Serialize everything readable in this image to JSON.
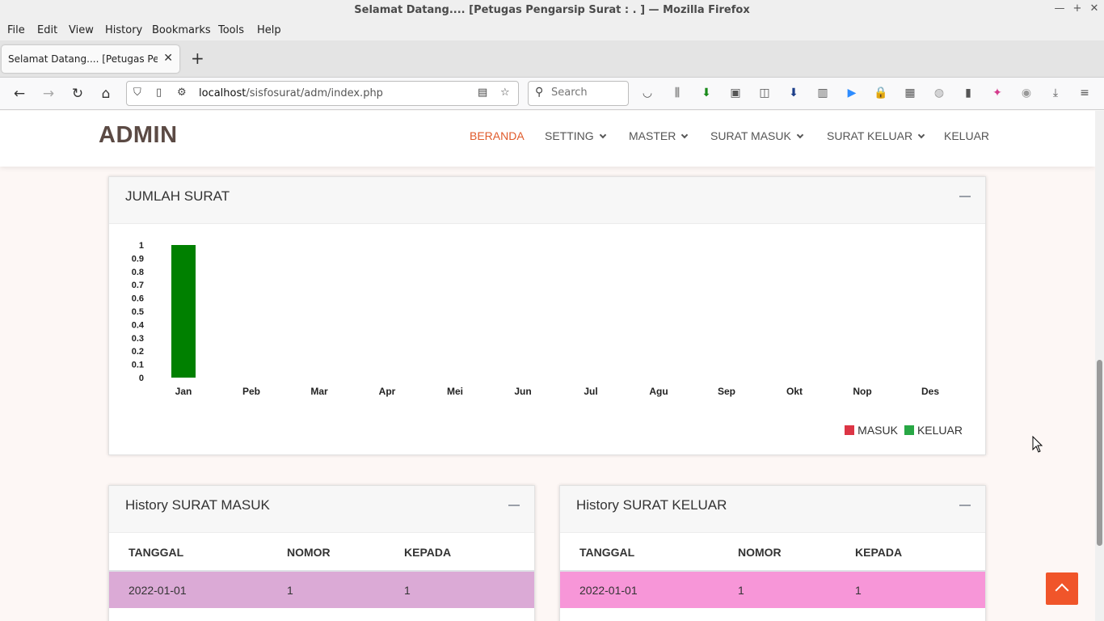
{
  "window": {
    "title": "Selamat Datang.... [Petugas Pengarsip Surat : . ] — Mozilla Firefox",
    "controls": [
      "—",
      "+",
      "✕"
    ]
  },
  "menu": [
    "File",
    "Edit",
    "View",
    "History",
    "Bookmarks",
    "Tools",
    "Help"
  ],
  "tab": {
    "label": "Selamat Datang.... [Petugas Pengarsip Surat : . ]",
    "close": "✕",
    "new": "+"
  },
  "nav": {
    "url_host": "localhost",
    "url_path": "/sisfosurat/adm/index.php",
    "search_placeholder": "Search"
  },
  "site": {
    "logo": "ADMIN",
    "menu": [
      "BERANDA",
      "SETTING",
      "MASTER",
      "SURAT MASUK",
      "SURAT KELUAR",
      "KELUAR"
    ],
    "active_color": "#e05a2a"
  },
  "chart_card": {
    "title": "JUMLAH SURAT"
  },
  "chart_data": {
    "type": "bar",
    "categories": [
      "Jan",
      "Peb",
      "Mar",
      "Apr",
      "Mei",
      "Jun",
      "Jul",
      "Agu",
      "Sep",
      "Okt",
      "Nop",
      "Des"
    ],
    "series": [
      {
        "name": "MASUK",
        "color": "#dc3545",
        "values": [
          0,
          0,
          0,
          0,
          0,
          0,
          0,
          0,
          0,
          0,
          0,
          0
        ]
      },
      {
        "name": "KELUAR",
        "color": "#008000",
        "legend_color": "#28a745",
        "values": [
          1,
          0,
          0,
          0,
          0,
          0,
          0,
          0,
          0,
          0,
          0,
          0
        ]
      }
    ],
    "yticks": [
      "0",
      "0.1",
      "0.2",
      "0.3",
      "0.4",
      "0.5",
      "0.6",
      "0.7",
      "0.8",
      "0.9",
      "1"
    ],
    "ylim": [
      0,
      1
    ],
    "legend": "bottom-right"
  },
  "history_masuk": {
    "title": "History SURAT MASUK",
    "columns": [
      "TANGGAL",
      "NOMOR",
      "KEPADA"
    ],
    "rows": [
      [
        "2022-01-01",
        "1",
        "1"
      ]
    ],
    "row_color": "#dbaad6"
  },
  "history_keluar": {
    "title": "History SURAT KELUAR",
    "columns": [
      "TANGGAL",
      "NOMOR",
      "KEPADA"
    ],
    "rows": [
      [
        "2022-01-01",
        "1",
        "1"
      ]
    ],
    "row_color": "#f796d8"
  }
}
